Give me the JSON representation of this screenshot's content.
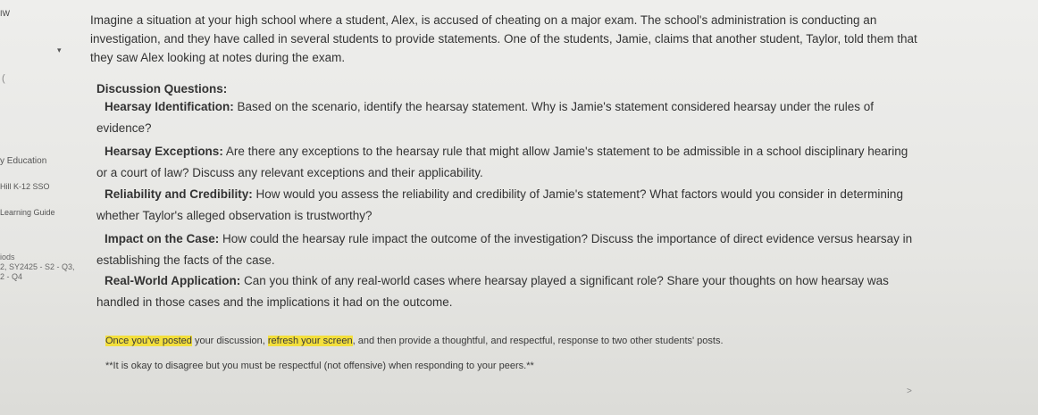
{
  "sidebar": {
    "top_label": "IW",
    "arrow": "▾",
    "paren": "(",
    "education": "y Education",
    "school": "Hill K-12 SSO",
    "guide": "Learning Guide",
    "dates_line1": "iods",
    "dates_line2": "2, SY2425 - S2 - Q3,",
    "dates_line3": "2 - Q4"
  },
  "intro": "Imagine a situation at your high school where a student, Alex, is accused of cheating on a major exam. The school's administration is conducting an investigation, and they have called in several students to provide statements. One of the students, Jamie, claims that another student, Taylor, told them that they saw Alex looking at notes during the exam.",
  "discussion_title": "Discussion Questions:",
  "questions": [
    {
      "label": "Hearsay Identification:",
      "text": " Based on the scenario, identify the hearsay statement. Why is Jamie's statement considered hearsay under the rules of evidence?"
    },
    {
      "label": "Hearsay Exceptions:",
      "text": " Are there any exceptions to the hearsay rule that might allow Jamie's statement to be admissible in a school disciplinary hearing or a court of law? Discuss any relevant exceptions and their applicability."
    },
    {
      "label": "Reliability and Credibility:",
      "text": " How would you assess the reliability and credibility of Jamie's statement? What factors would you consider in determining whether Taylor's alleged observation is trustworthy?"
    },
    {
      "label": "Impact on the Case:",
      "text": " How could the hearsay rule impact the outcome of the investigation? Discuss the importance of direct evidence versus hearsay in establishing the facts of the case."
    },
    {
      "label": "Real-World Application:",
      "text": " Can you think of any real-world cases where hearsay played a significant role? Share your thoughts on how hearsay was handled in those cases and the implications it had on the outcome."
    }
  ],
  "note": {
    "hl1": "Once you've posted",
    "mid1": " your discussion, ",
    "hl2": "refresh your screen",
    "rest": ", and then provide a thoughtful, and respectful, response to two other students' posts."
  },
  "note2": "**It is okay to disagree but you must be respectful (not offensive) when responding to your peers.**",
  "cursor": ">"
}
